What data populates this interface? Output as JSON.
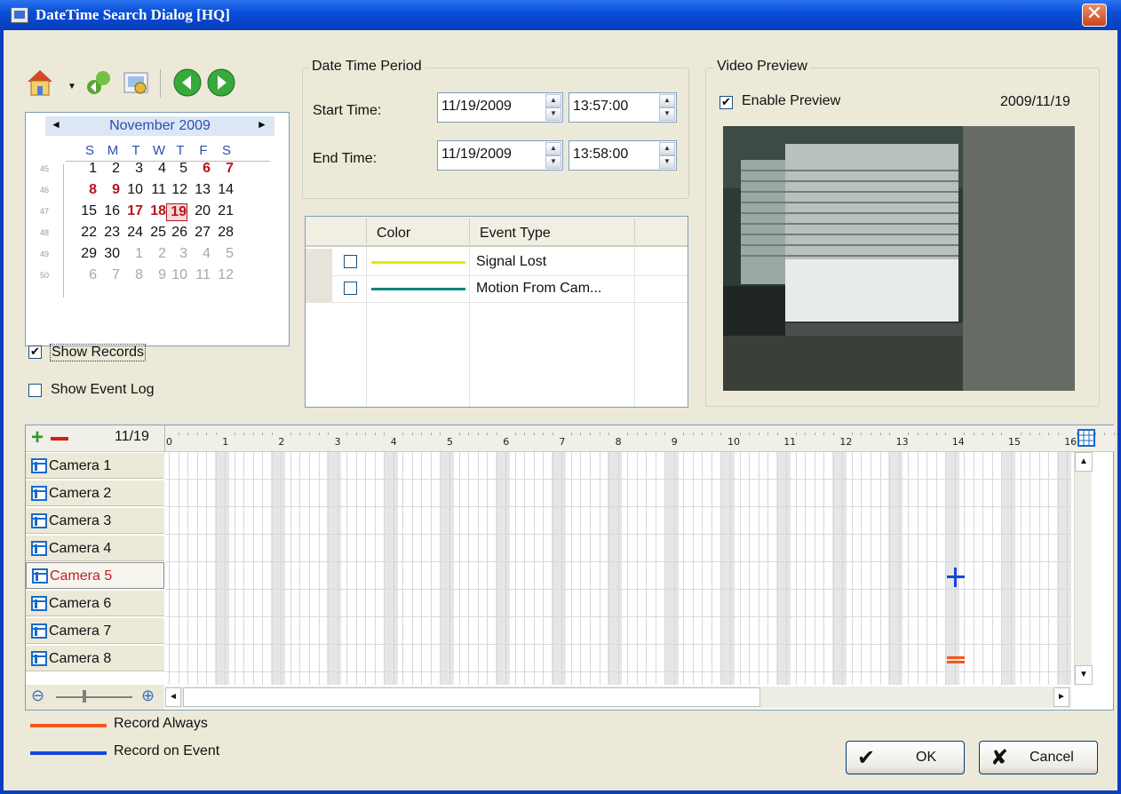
{
  "window": {
    "title": "DateTime Search Dialog  [HQ]",
    "close_glyph": "✕",
    "colors": {
      "titlebar": "#0a4fd8",
      "client": "#ece9d8",
      "record_always": "#f4571d",
      "record_on_event": "#1746d6"
    }
  },
  "toolbar": {
    "icons": [
      "home-icon",
      "dropdown-arrow-icon",
      "refresh-icon",
      "search-settings-icon",
      "previous-icon",
      "next-icon"
    ]
  },
  "calendar": {
    "month_label": "November 2009",
    "prev_glyph": "◄",
    "next_glyph": "►",
    "weekdays": [
      "S",
      "M",
      "T",
      "W",
      "T",
      "F",
      "S"
    ],
    "week_numbers": [
      "45",
      "46",
      "47",
      "48",
      "49",
      "50"
    ],
    "weeks": [
      [
        "1",
        "2",
        "3",
        "4",
        "5",
        "6",
        "7"
      ],
      [
        "8",
        "9",
        "10",
        "11",
        "12",
        "13",
        "14"
      ],
      [
        "15",
        "16",
        "17",
        "18",
        "19",
        "20",
        "21"
      ],
      [
        "22",
        "23",
        "24",
        "25",
        "26",
        "27",
        "28"
      ],
      [
        "29",
        "30",
        "1",
        "2",
        "3",
        "4",
        "5"
      ],
      [
        "6",
        "7",
        "8",
        "9",
        "10",
        "11",
        "12"
      ]
    ],
    "bold_days": [
      "6",
      "7",
      "8",
      "9",
      "17",
      "18",
      "19"
    ],
    "selected_day": "19"
  },
  "options": {
    "show_records": {
      "label": "Show Records",
      "checked": true
    },
    "show_event_log": {
      "label": "Show Event Log",
      "checked": false
    },
    "check_glyph": "✔"
  },
  "date_time_period": {
    "title": "Date Time Period",
    "start_label": "Start Time:",
    "start_date": "11/19/2009",
    "start_time": "13:57:00",
    "end_label": "End Time:",
    "end_date": "11/19/2009",
    "end_time": "13:58:00",
    "spin_up": "▲",
    "spin_down": "▼"
  },
  "event_table": {
    "columns": [
      "Color",
      "Event Type"
    ],
    "rows": [
      {
        "type": "Signal Lost",
        "color": "#f2e600",
        "checked": false
      },
      {
        "type": "Motion From Cam...",
        "color": "#12837a",
        "checked": false
      }
    ]
  },
  "video_preview": {
    "title": "Video Preview",
    "enable_label": "Enable Preview",
    "enabled": true,
    "date": "2009/11/19"
  },
  "timeline": {
    "date_label": "11/19",
    "hour_labels": [
      "0",
      "1",
      "2",
      "3",
      "4",
      "5",
      "6",
      "7",
      "8",
      "9",
      "10",
      "11",
      "12",
      "13",
      "14",
      "15",
      "16"
    ],
    "cameras": [
      {
        "label": "Camera 1",
        "selected": false
      },
      {
        "label": "Camera 2",
        "selected": false
      },
      {
        "label": "Camera 3",
        "selected": false
      },
      {
        "label": "Camera 4",
        "selected": false
      },
      {
        "label": "Camera 5",
        "selected": true
      },
      {
        "label": "Camera 6",
        "selected": false
      },
      {
        "label": "Camera 7",
        "selected": false
      },
      {
        "label": "Camera 8",
        "selected": false
      }
    ],
    "markers": [
      {
        "camera": "Camera 5",
        "hour": 14.0,
        "kind": "record_on_event"
      },
      {
        "camera": "Camera 8",
        "hour": 14.0,
        "kind": "record_always"
      }
    ],
    "zoom_icons": [
      "zoom-out-icon",
      "zoom-in-icon"
    ],
    "scroll_up": "▲",
    "scroll_down": "▼",
    "scroll_left": "◄",
    "scroll_right": "►"
  },
  "legend": {
    "record_always": "Record Always",
    "record_on_event": "Record on Event"
  },
  "buttons": {
    "ok": "OK",
    "cancel": "Cancel",
    "ok_glyph": "✔",
    "cancel_glyph": "✘"
  }
}
